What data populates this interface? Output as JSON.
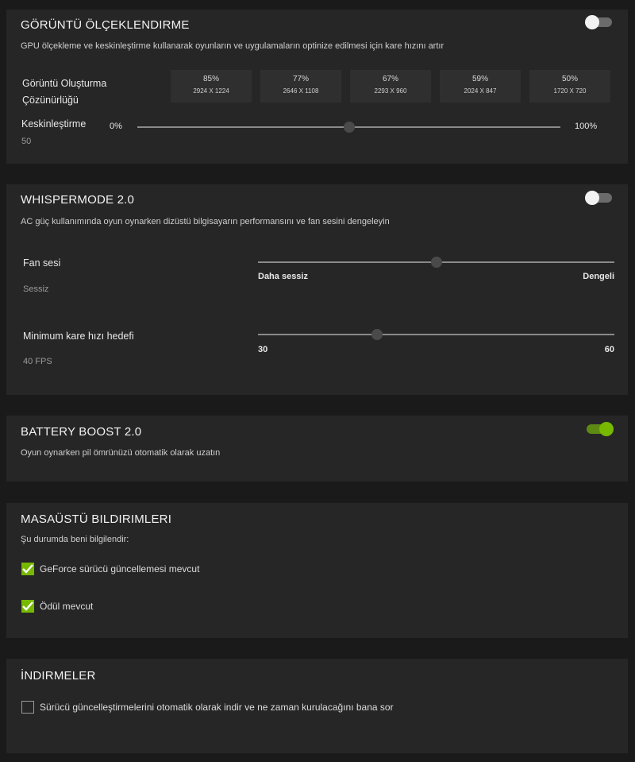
{
  "scaling": {
    "title": "GÖRÜNTÜ ÖLÇEKLENDIRME",
    "description": "GPU ölçekleme ve keskinleştirme kullanarak oyunların ve uygulamaların optinize edilmesi için kare hızını artır",
    "toggle_on": false,
    "render_label_line1": "Görüntü Oluşturma",
    "render_label_line2": "Çözünürlüğü",
    "resolutions": [
      {
        "pct": "85%",
        "dim": "2924 X 1224"
      },
      {
        "pct": "77%",
        "dim": "2646 X 1108"
      },
      {
        "pct": "67%",
        "dim": "2293 X 960"
      },
      {
        "pct": "59%",
        "dim": "2024 X 847"
      },
      {
        "pct": "50%",
        "dim": "1720 X 720"
      }
    ],
    "sharpen_label": "Keskinleştirme",
    "sharpen_value": "50",
    "sharpen_min": "0%",
    "sharpen_max": "100%",
    "sharpen_level": 0.5
  },
  "whisper": {
    "title": "WHISPERMODE 2.0",
    "description": "AC güç kullanımında oyun oynarken dizüstü bilgisayarın performansını ve fan sesini dengeleyin",
    "toggle_on": false,
    "fan_label": "Fan sesi",
    "fan_value": "Sessiz",
    "fan_min": "Daha sessiz",
    "fan_max": "Dengeli",
    "fan_level": 0.5,
    "fps_label": "Minimum kare hızı hedefi",
    "fps_value": "40 FPS",
    "fps_min": "30",
    "fps_max": "60",
    "fps_level": 0.333
  },
  "battery": {
    "title": "BATTERY BOOST 2.0",
    "description": "Oyun oynarken pil ömrünüzü otomatik olarak uzatın",
    "toggle_on": true
  },
  "notifications": {
    "title": "MASAÜSTÜ BILDIRIMLERI",
    "subtitle": "Şu durumda beni bilgilendir:",
    "items": [
      {
        "label": "GeForce sürücü güncellemesi mevcut",
        "checked": true
      },
      {
        "label": "Ödül mevcut",
        "checked": true
      }
    ]
  },
  "downloads": {
    "title": "İNDIRMELER",
    "items": [
      {
        "label": "Sürücü güncelleştirmelerini otomatik olarak indir ve ne zaman kurulacağını bana sor",
        "checked": false
      }
    ]
  },
  "colors": {
    "accent": "#76b900",
    "panel": "#262626",
    "background": "#1a1a1a"
  }
}
